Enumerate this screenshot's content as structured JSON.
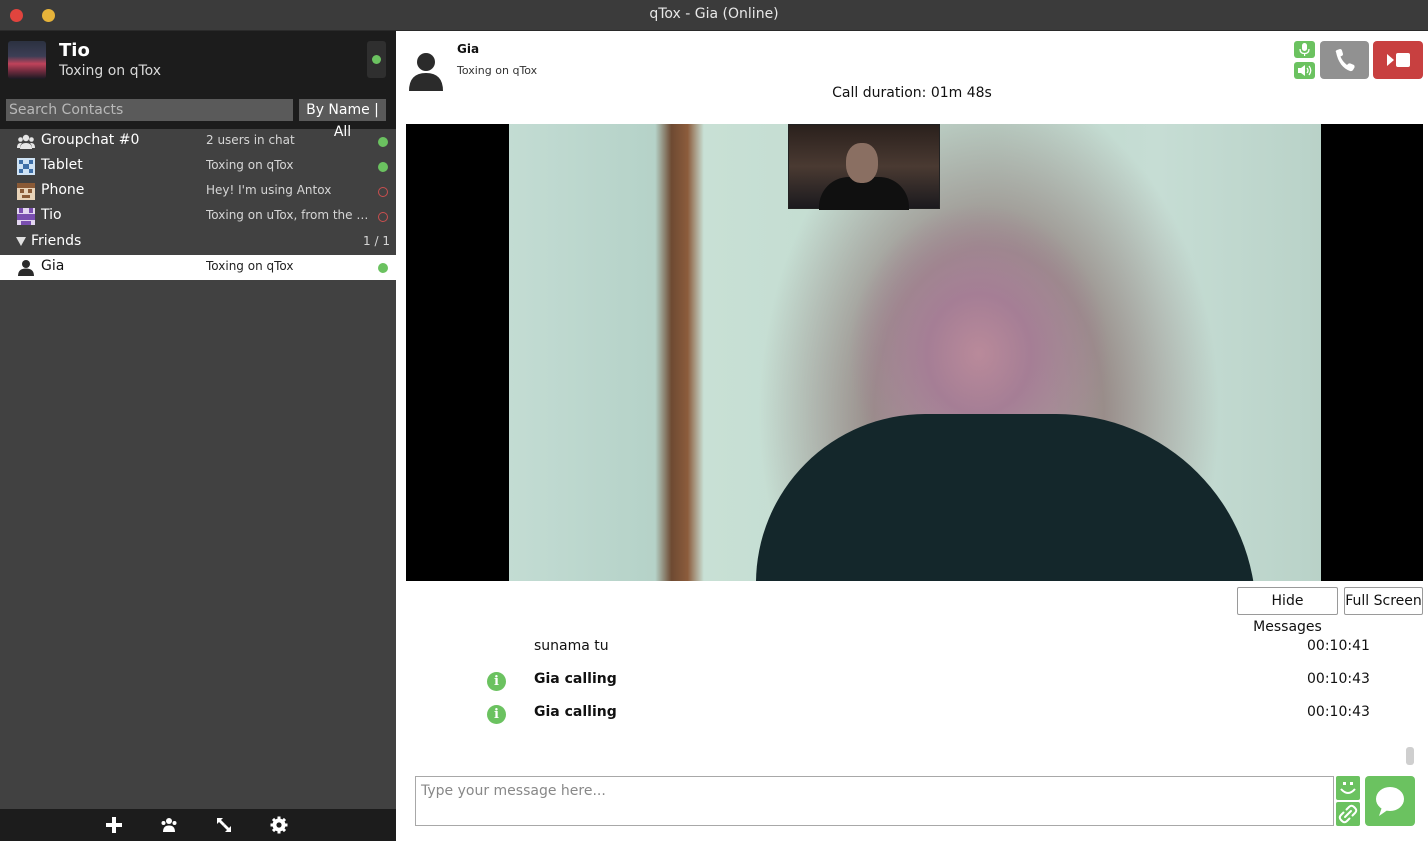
{
  "window": {
    "title": "qTox - Gia (Online)"
  },
  "profile": {
    "name": "Tio",
    "status": "Toxing on qTox"
  },
  "search": {
    "placeholder": "Search Contacts",
    "filter_label": "By Name | All"
  },
  "contacts": [
    {
      "name": "Groupchat #0",
      "status": "2 users in chat",
      "state": "online",
      "icon": "group-icon"
    },
    {
      "name": "Tablet",
      "status": "Toxing on qTox",
      "state": "online",
      "icon": "identicon-icon"
    },
    {
      "name": "Phone",
      "status": "Hey! I'm using Antox",
      "state": "offline",
      "icon": "identicon-icon"
    },
    {
      "name": "Tio",
      "status": "Toxing on uTox, from the fu...",
      "state": "offline",
      "icon": "identicon-icon"
    }
  ],
  "friends_group": {
    "label": "Friends",
    "count": "1 / 1"
  },
  "friends": [
    {
      "name": "Gia",
      "status": "Toxing on qTox",
      "state": "online",
      "icon": "user-icon"
    }
  ],
  "chat": {
    "name": "Gia",
    "status": "Toxing on qTox",
    "call_duration": "Call duration: 01m 48s",
    "hide_messages_label": "Hide Messages",
    "full_screen_label": "Full Screen"
  },
  "messages": [
    {
      "text": "sunama tu",
      "time": "00:10:41",
      "type": "message"
    },
    {
      "text": "Gia calling",
      "time": "00:10:43",
      "type": "info"
    },
    {
      "text": "Gia calling",
      "time": "00:10:43",
      "type": "info"
    }
  ],
  "input": {
    "placeholder": "Type your message here..."
  },
  "colors": {
    "accent_green": "#6bc260",
    "hangup_red": "#c84040",
    "sidebar_bg": "#414141",
    "sidebar_header_bg": "#1c1c1c",
    "offline_red": "#c94f4f"
  },
  "icons": {
    "bottom_bar": [
      "add-icon",
      "groupchat-icon",
      "transfer-icon",
      "settings-icon"
    ]
  }
}
